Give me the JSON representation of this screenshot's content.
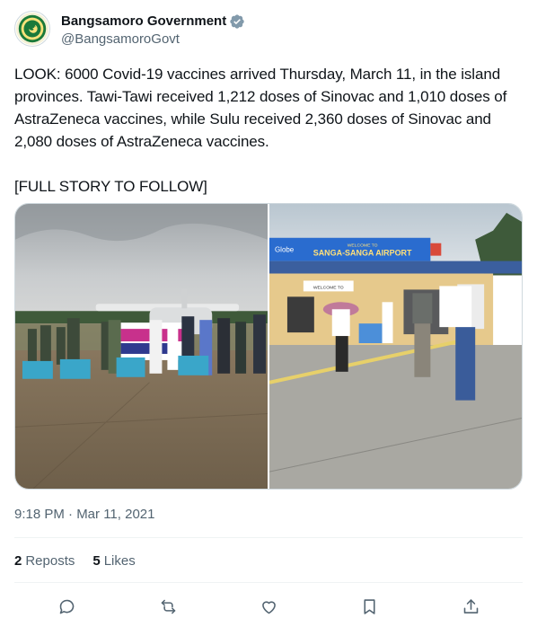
{
  "author": {
    "display_name": "Bangsamoro Government",
    "handle": "@BangsamoroGovt",
    "avatar_icon": "bangsamoro-seal-icon",
    "verified_icon": "verified-badge-icon",
    "verified_color": "#829aab"
  },
  "tweet": {
    "text": "LOOK: 6000 Covid-19 vaccines arrived Thursday, March 11, in the island provinces. Tawi-Tawi received 1,212 doses of Sinovac and 1,010 doses of AstraZeneca vaccines, while Sulu received 2,360 doses of Sinovac and 2,080 doses of AstraZeneca vaccines.\n\n[FULL STORY TO FOLLOW]",
    "timestamp": "9:18 PM · Mar 11, 2021"
  },
  "media": {
    "photo_left": {
      "banner_text": "SSA\nASANGGA!"
    },
    "photo_right": {
      "sign_top": "WELCOME TO",
      "sign_name": "SANGA-SANGA AIRPORT",
      "sign_brand": "Globe",
      "welcome_sign": "WELCOME TO"
    }
  },
  "stats": {
    "reposts_count": "2",
    "reposts_label": "Reposts",
    "likes_count": "5",
    "likes_label": "Likes"
  },
  "actions": {
    "reply_icon": "reply-icon",
    "repost_icon": "repost-icon",
    "like_icon": "heart-icon",
    "bookmark_icon": "bookmark-icon",
    "share_icon": "share-icon"
  },
  "colors": {
    "text_primary": "#0f1419",
    "text_secondary": "#536471",
    "border": "#cfd9de"
  }
}
